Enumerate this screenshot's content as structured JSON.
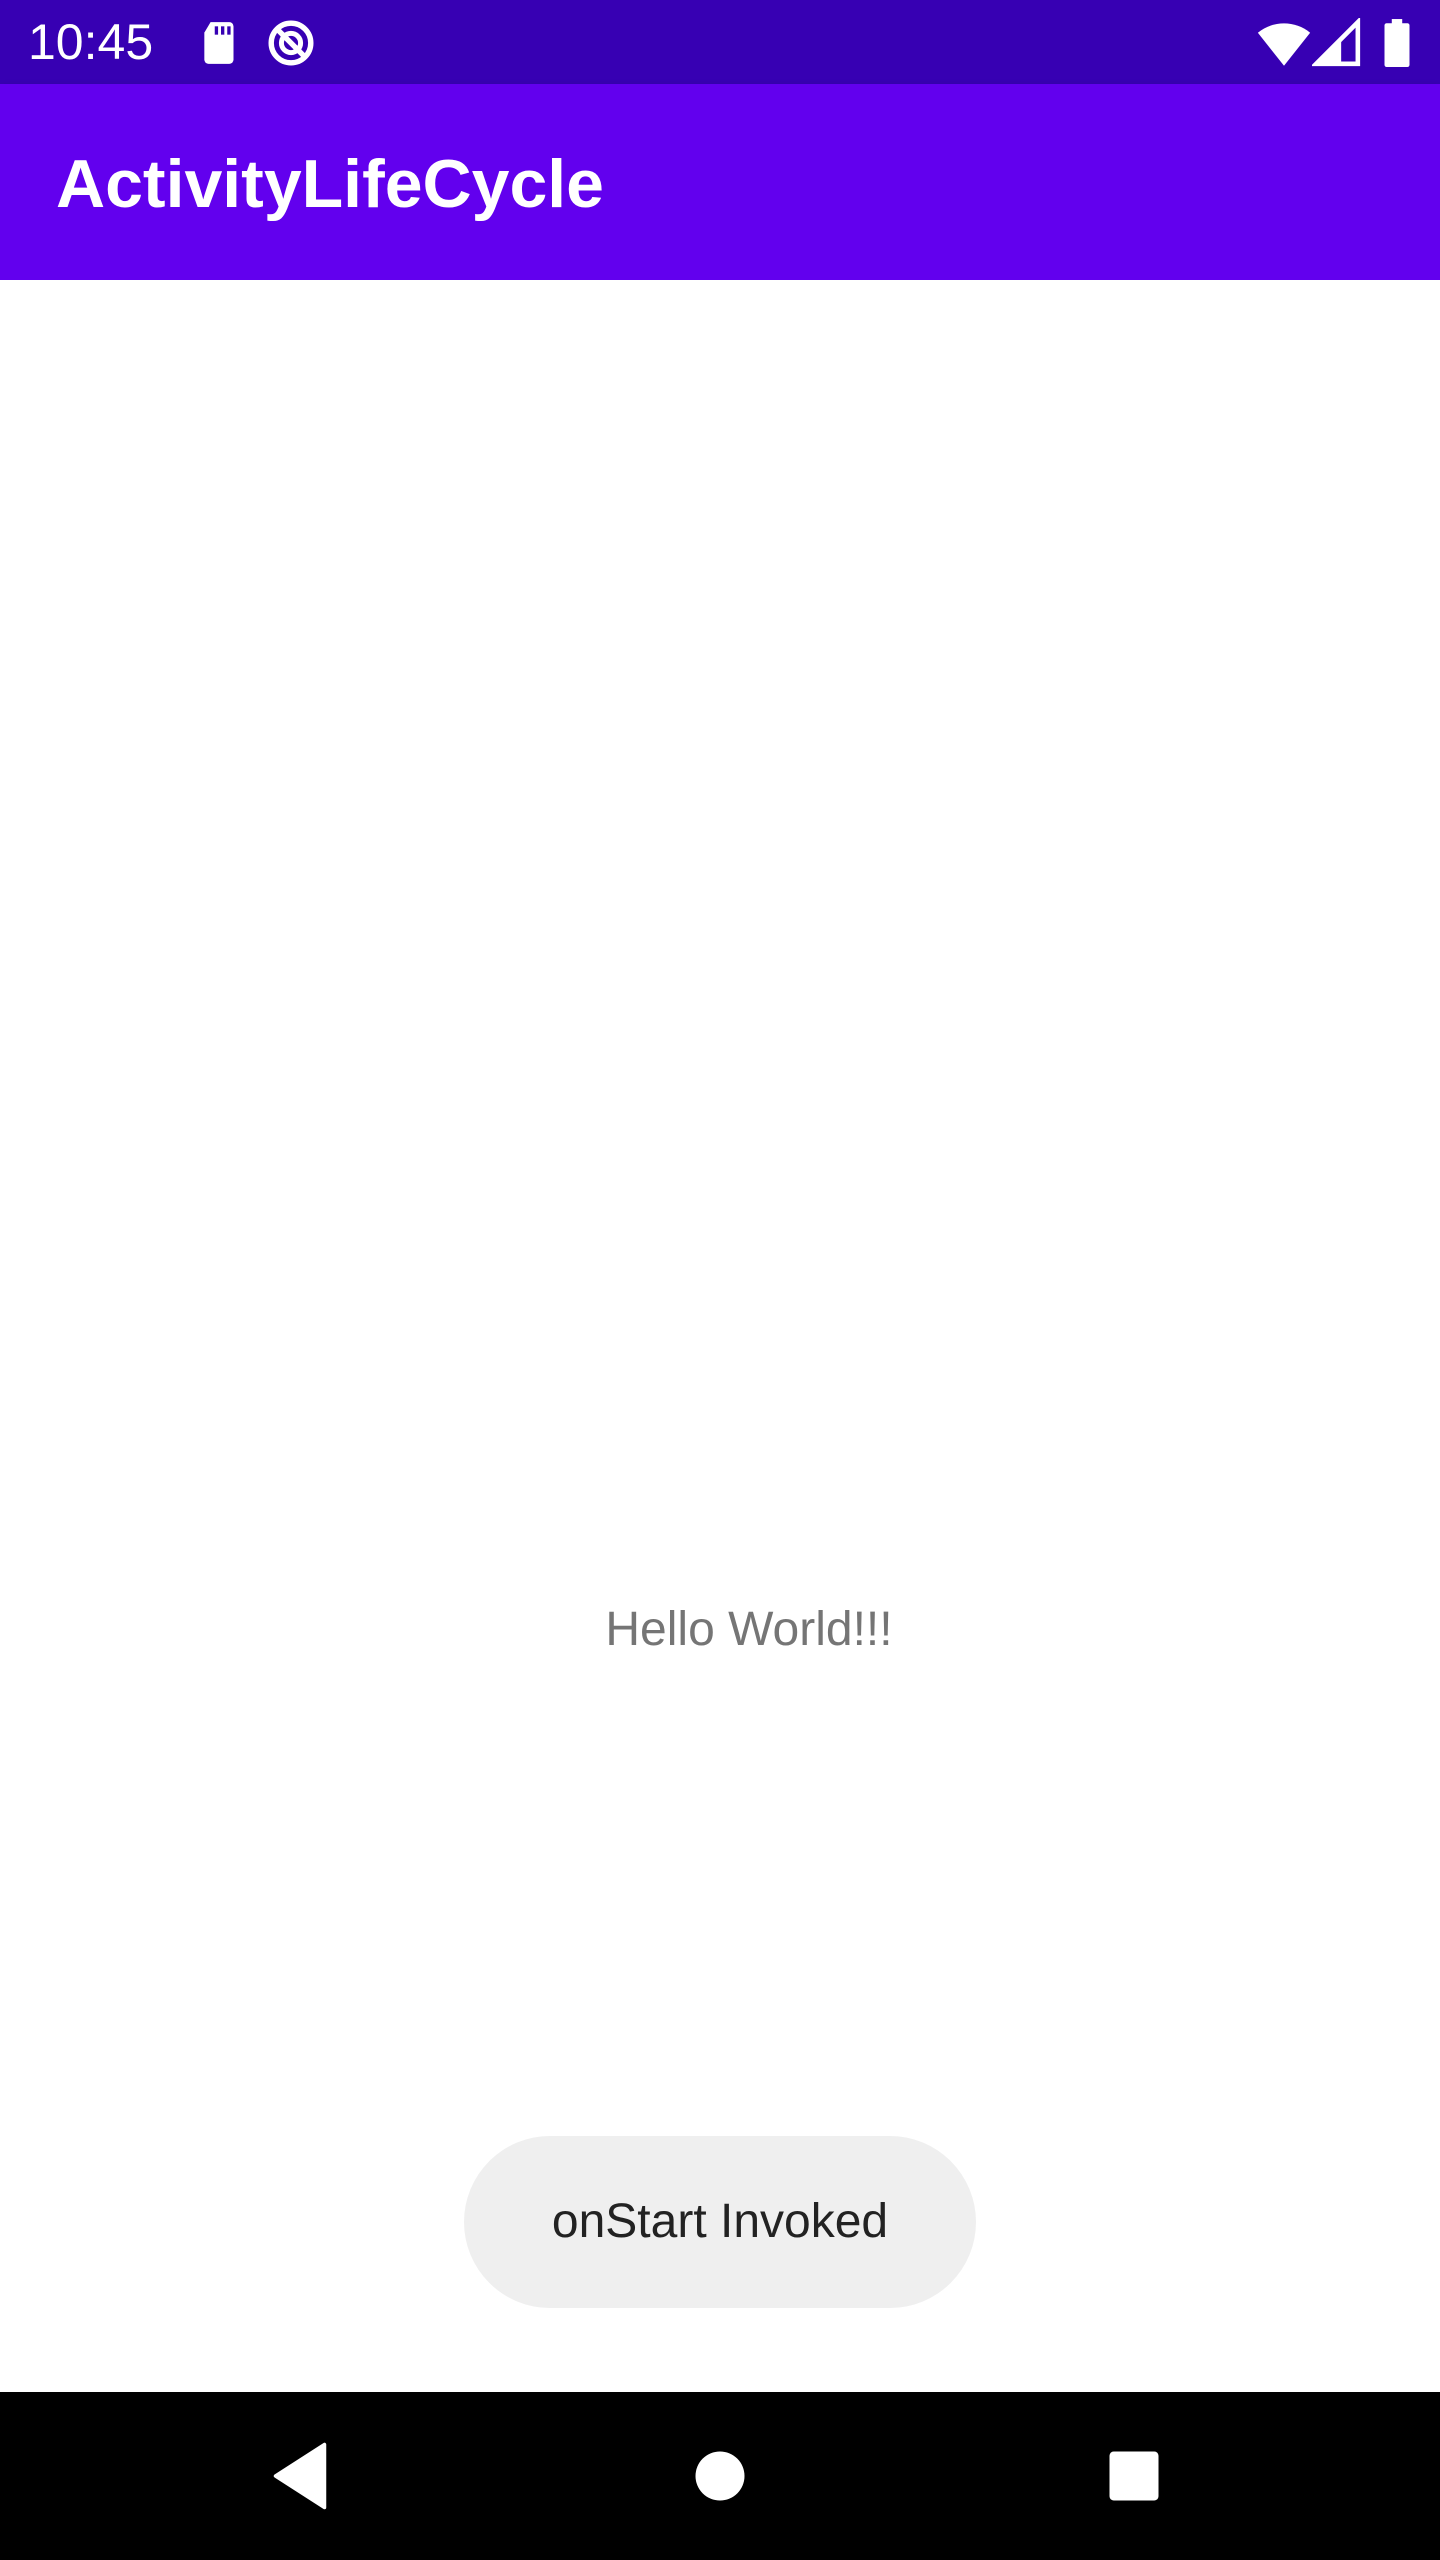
{
  "status_bar": {
    "time": "10:45",
    "icons_left": [
      "sd-card-icon",
      "do-not-disturb-icon"
    ],
    "icons_right": [
      "wifi-icon",
      "cell-signal-icon",
      "battery-icon"
    ],
    "color": "#3700b3"
  },
  "app_bar": {
    "title": "ActivityLifeCycle",
    "color": "#6200ee"
  },
  "main": {
    "hello_text": "Hello World!!!"
  },
  "toast": {
    "text": "onStart Invoked"
  },
  "nav_bar": {
    "buttons": [
      "back-icon",
      "home-icon",
      "recents-icon"
    ]
  }
}
